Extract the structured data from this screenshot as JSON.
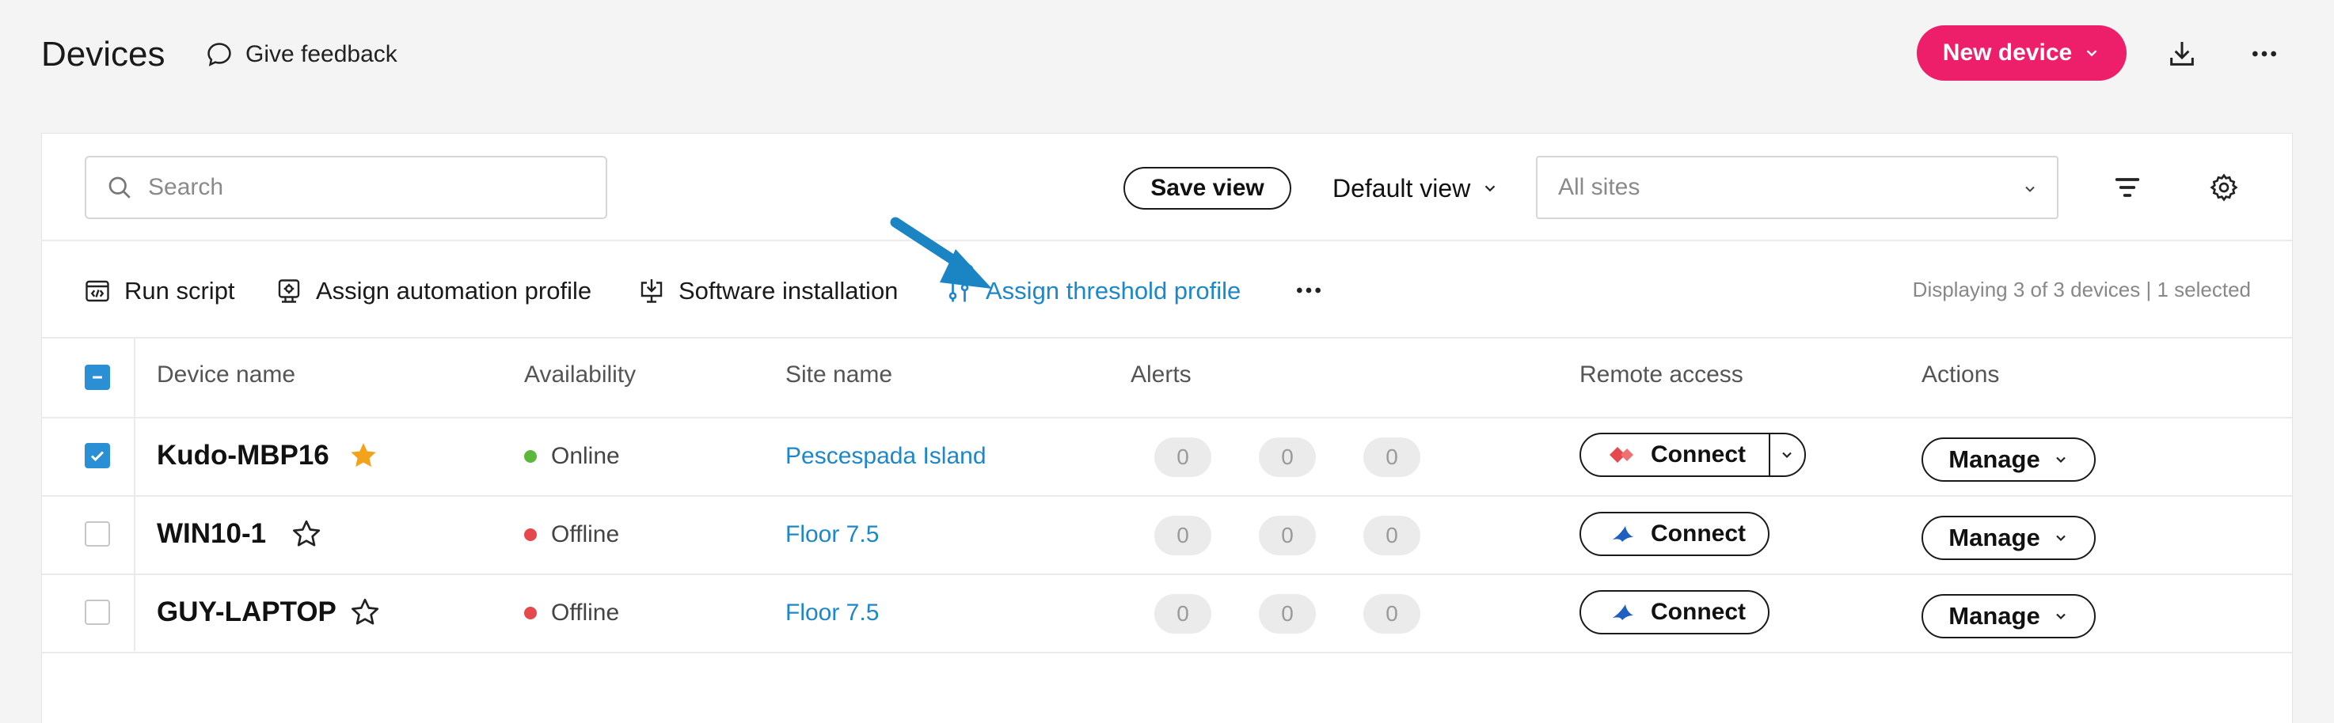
{
  "header": {
    "title": "Devices",
    "feedback_label": "Give feedback",
    "new_device_label": "New device"
  },
  "toolbar": {
    "search_placeholder": "Search",
    "save_view_label": "Save view",
    "default_view_label": "Default view",
    "sites_placeholder": "All sites"
  },
  "actions": {
    "run_script": "Run script",
    "assign_automation": "Assign automation profile",
    "software_installation": "Software installation",
    "assign_threshold": "Assign threshold profile",
    "count_text": "Displaying 3 of 3 devices | 1 selected"
  },
  "table": {
    "headers": {
      "device_name": "Device name",
      "availability": "Availability",
      "site_name": "Site name",
      "alerts": "Alerts",
      "remote_access": "Remote access",
      "actions": "Actions"
    },
    "rows": [
      {
        "device_name": "Kudo-MBP16",
        "favorite": true,
        "selected": true,
        "availability": "Online",
        "status_color": "#5cb83a",
        "site": "Pescespada Island",
        "alerts": [
          "0",
          "0",
          "0"
        ],
        "connect_label": "Connect",
        "remote_icon": "anydesk-icon",
        "has_split": true,
        "manage_label": "Manage"
      },
      {
        "device_name": "WIN10-1",
        "favorite": false,
        "selected": false,
        "availability": "Offline",
        "status_color": "#e5484d",
        "site": "Floor 7.5",
        "alerts": [
          "0",
          "0",
          "0"
        ],
        "connect_label": "Connect",
        "remote_icon": "splashtop-icon",
        "has_split": false,
        "manage_label": "Manage"
      },
      {
        "device_name": "GUY-LAPTOP",
        "favorite": false,
        "selected": false,
        "availability": "Offline",
        "status_color": "#e5484d",
        "site": "Floor 7.5",
        "alerts": [
          "0",
          "0",
          "0"
        ],
        "connect_label": "Connect",
        "remote_icon": "splashtop-icon",
        "has_split": false,
        "manage_label": "Manage"
      }
    ]
  },
  "colors": {
    "accent_pink": "#ee1f6a",
    "link_blue": "#1d87c9",
    "checkbox_blue": "#2b8fd6",
    "favorite_star": "#f2a31b"
  }
}
